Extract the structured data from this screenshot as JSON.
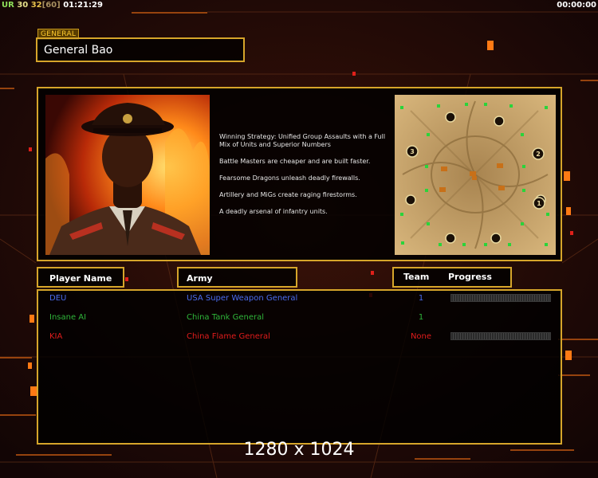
{
  "hud": {
    "ur": "UR",
    "n30": "30",
    "n32": "32",
    "n60": "[60]",
    "time_left": "01:21:29",
    "time_right": "00:00:00"
  },
  "section_tab": "GENERAL",
  "general_name": "General Bao",
  "description": [
    "Winning Strategy: Unified Group Assaults with a Full Mix of Units and Superior Numbers",
    "Battle Masters are cheaper and are built faster.",
    "Fearsome Dragons unleash deadly firewalls.",
    "Artillery and MiGs create raging firestorms.",
    "A deadly arsenal of infantry units."
  ],
  "minimap": {
    "start_labels": [
      "3",
      "2",
      "1"
    ]
  },
  "table": {
    "headers": {
      "player": "Player Name",
      "army": "Army",
      "team": "Team",
      "progress": "Progress"
    },
    "rows": [
      {
        "name": "DEU",
        "army": "USA Super Weapon General",
        "team": "1",
        "color": "#4a6cf0",
        "show_progress": true
      },
      {
        "name": "Insane AI",
        "army": "China Tank General",
        "team": "1",
        "color": "#2fb53a",
        "show_progress": false
      },
      {
        "name": "KIA",
        "army": "China Flame General",
        "team": "None",
        "color": "#e01c1c",
        "show_progress": true
      }
    ]
  },
  "caption": "1280 x 1024"
}
